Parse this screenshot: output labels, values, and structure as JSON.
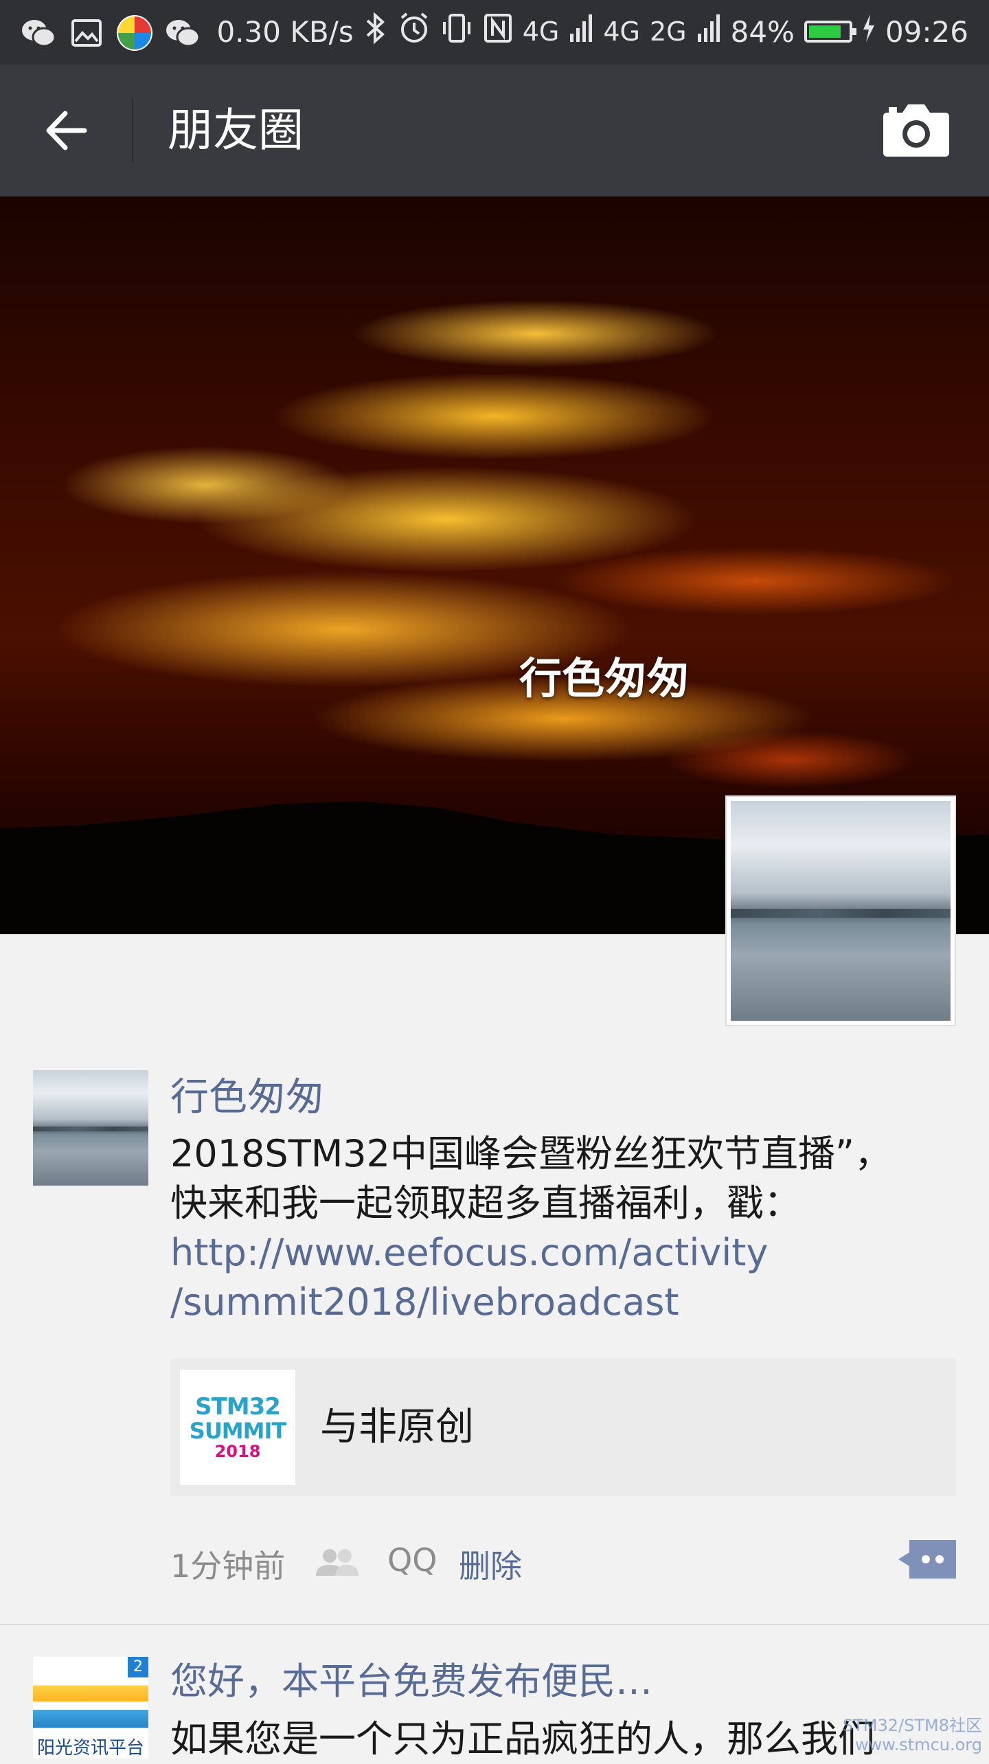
{
  "status_bar": {
    "net_speed": "0.30 KB/s",
    "signal_1": "4G",
    "signal_2": "4G",
    "signal_3": "2G",
    "battery_level": 0.84,
    "battery": "84%",
    "time": "09:26",
    "icons": [
      "wechat-icon",
      "gallery-icon",
      "pinwheel-app-icon",
      "wechat-icon",
      "bluetooth-icon",
      "alarm-icon",
      "vibrate-icon",
      "nfc-icon",
      "signal-icon",
      "battery-icon",
      "charging-icon"
    ]
  },
  "header": {
    "title": "朋友圈",
    "back_icon": "arrow-left-icon",
    "camera_icon": "camera-icon"
  },
  "cover": {
    "user_name": "行色匆匆"
  },
  "post": {
    "author": "行色匆匆",
    "text_line1": "2018STM32中国峰会暨粉丝狂欢节直播”，",
    "text_line2": "快来和我一起领取超多直播福利，戳：",
    "link_line1": "http://www.eefocus.com/activity",
    "link_line2": "/summit2018/livebroadcast",
    "share_card": {
      "thumb_text_1": "STM32",
      "thumb_text_2": "SUMMIT",
      "thumb_text_3": "2018",
      "title": "与非原创"
    },
    "time": "1分钟前",
    "visibility": "QQ",
    "delete_label": "删除",
    "comment_icon": "comment-dots-icon"
  },
  "next_post": {
    "author": "您好，本平台免费发布便民…",
    "text": "如果您是一个只为正品疯狂的人，那么我们",
    "avatar_caption": "阳光资讯平台",
    "avatar_badge": "2",
    "watermark_1": "STM32/STM8社区",
    "watermark_2": "www.stmcu.org"
  }
}
